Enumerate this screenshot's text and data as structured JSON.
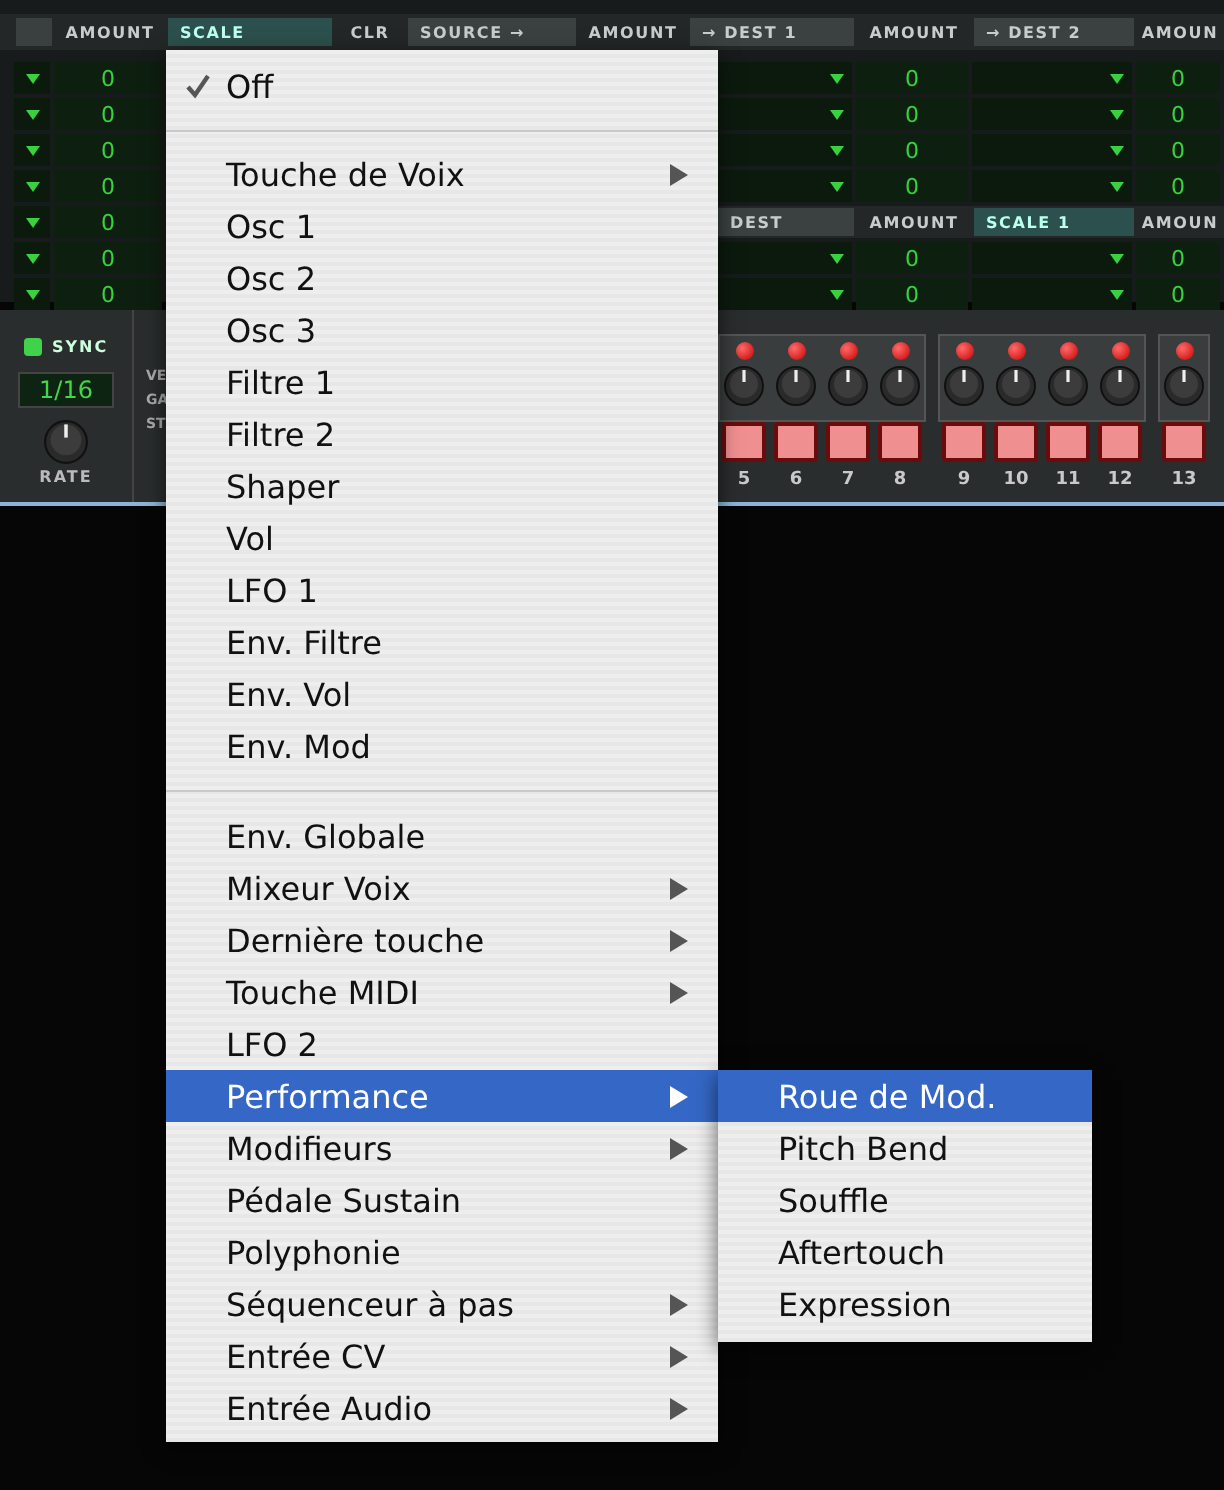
{
  "header": [
    {
      "label": "AMOUNT",
      "kind": "plain"
    },
    {
      "label": "SCALE",
      "kind": "active"
    },
    {
      "label": "CLR",
      "kind": "plain"
    },
    {
      "label": "SOURCE →",
      "kind": "field"
    },
    {
      "label": "AMOUNT",
      "kind": "plain"
    },
    {
      "label": "→ DEST 1",
      "kind": "field"
    },
    {
      "label": "AMOUNT",
      "kind": "plain"
    },
    {
      "label": "→ DEST 2",
      "kind": "field"
    },
    {
      "label": "AMOUN",
      "kind": "plain"
    }
  ],
  "left_amounts": [
    "0",
    "0",
    "0",
    "0",
    "0",
    "0",
    "0"
  ],
  "routing_rows": [
    {
      "amount_a": "0",
      "amount_b": "0"
    },
    {
      "amount_a": "0",
      "amount_b": "0"
    },
    {
      "amount_a": "0",
      "amount_b": "0"
    },
    {
      "amount_a": "0",
      "amount_b": "0"
    }
  ],
  "lower_header": [
    {
      "label": "DEST",
      "kind": "field"
    },
    {
      "label": "AMOUNT",
      "kind": "plain"
    },
    {
      "label": "SCALE 1",
      "kind": "active"
    },
    {
      "label": "AMOUN",
      "kind": "plain"
    }
  ],
  "lower_rows": [
    {
      "amount_a": "0",
      "amount_b": "0"
    },
    {
      "amount_a": "0",
      "amount_b": "0"
    }
  ],
  "sequencer": {
    "sync": {
      "label": "SYNC",
      "on": true
    },
    "rate_value": "1/16",
    "rate_label": "RATE",
    "row_labels": [
      "VE",
      "GA",
      "ST"
    ],
    "steps": [
      {
        "number": "5",
        "led_on": true,
        "pad_on": true
      },
      {
        "number": "6",
        "led_on": true,
        "pad_on": true
      },
      {
        "number": "7",
        "led_on": true,
        "pad_on": true
      },
      {
        "number": "8",
        "led_on": true,
        "pad_on": true
      },
      {
        "number": "9",
        "led_on": true,
        "pad_on": true
      },
      {
        "number": "10",
        "led_on": true,
        "pad_on": true
      },
      {
        "number": "11",
        "led_on": true,
        "pad_on": true
      },
      {
        "number": "12",
        "led_on": true,
        "pad_on": true
      },
      {
        "number": "13",
        "led_on": true,
        "pad_on": true
      }
    ]
  },
  "menu": {
    "sections": [
      {
        "items": [
          {
            "label": "Off",
            "checked": true,
            "submenu": false,
            "selected": false
          }
        ]
      },
      {
        "items": [
          {
            "label": "Touche de Voix",
            "checked": false,
            "submenu": true,
            "selected": false
          },
          {
            "label": "Osc 1",
            "checked": false,
            "submenu": false,
            "selected": false
          },
          {
            "label": "Osc 2",
            "checked": false,
            "submenu": false,
            "selected": false
          },
          {
            "label": "Osc 3",
            "checked": false,
            "submenu": false,
            "selected": false
          },
          {
            "label": "Filtre 1",
            "checked": false,
            "submenu": false,
            "selected": false
          },
          {
            "label": "Filtre 2",
            "checked": false,
            "submenu": false,
            "selected": false
          },
          {
            "label": "Shaper",
            "checked": false,
            "submenu": false,
            "selected": false
          },
          {
            "label": "Vol",
            "checked": false,
            "submenu": false,
            "selected": false
          },
          {
            "label": "LFO 1",
            "checked": false,
            "submenu": false,
            "selected": false
          },
          {
            "label": "Env. Filtre",
            "checked": false,
            "submenu": false,
            "selected": false
          },
          {
            "label": "Env. Vol",
            "checked": false,
            "submenu": false,
            "selected": false
          },
          {
            "label": "Env. Mod",
            "checked": false,
            "submenu": false,
            "selected": false
          }
        ]
      },
      {
        "items": [
          {
            "label": "Env. Globale",
            "checked": false,
            "submenu": false,
            "selected": false
          },
          {
            "label": "Mixeur Voix",
            "checked": false,
            "submenu": true,
            "selected": false
          },
          {
            "label": "Dernière touche",
            "checked": false,
            "submenu": true,
            "selected": false
          },
          {
            "label": "Touche MIDI",
            "checked": false,
            "submenu": true,
            "selected": false
          },
          {
            "label": "LFO 2",
            "checked": false,
            "submenu": false,
            "selected": false
          },
          {
            "label": "Performance",
            "checked": false,
            "submenu": true,
            "selected": true
          },
          {
            "label": "Modifieurs",
            "checked": false,
            "submenu": true,
            "selected": false
          },
          {
            "label": "Pédale Sustain",
            "checked": false,
            "submenu": false,
            "selected": false
          },
          {
            "label": "Polyphonie",
            "checked": false,
            "submenu": false,
            "selected": false
          },
          {
            "label": "Séquenceur à pas",
            "checked": false,
            "submenu": true,
            "selected": false
          },
          {
            "label": "Entrée CV",
            "checked": false,
            "submenu": true,
            "selected": false
          },
          {
            "label": "Entrée Audio",
            "checked": false,
            "submenu": true,
            "selected": false
          }
        ]
      }
    ]
  },
  "submenu": {
    "items": [
      {
        "label": "Roue de Mod.",
        "selected": true
      },
      {
        "label": "Pitch Bend",
        "selected": false
      },
      {
        "label": "Souffle",
        "selected": false
      },
      {
        "label": "Aftertouch",
        "selected": false
      },
      {
        "label": "Expression",
        "selected": false
      }
    ]
  }
}
